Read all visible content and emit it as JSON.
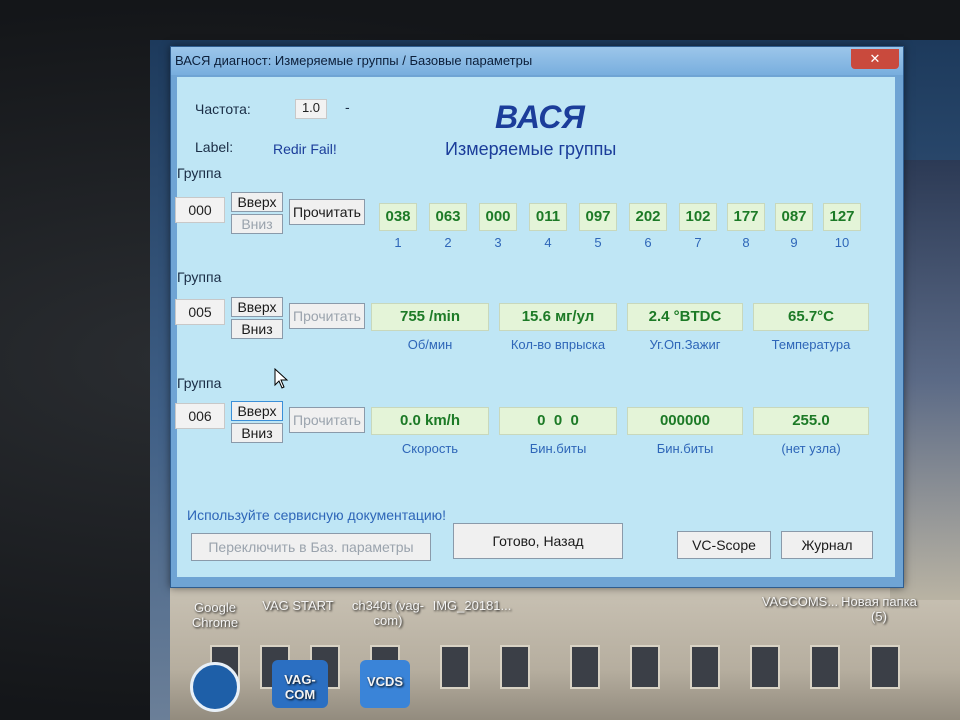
{
  "window": {
    "title": "ВАСЯ диагност: Измеряемые группы / Базовые параметры",
    "close": "✕"
  },
  "header": {
    "freq_label": "Частота:",
    "freq_value": "1.0",
    "freq_dash": "-",
    "label_label": "Label:",
    "label_value": "Redir Fail!",
    "app_name": "ВАСЯ",
    "subtitle": "Измеряемые группы"
  },
  "group_label": "Группа",
  "buttons": {
    "up": "Вверх",
    "down": "Вниз",
    "read": "Прочитать"
  },
  "group1": {
    "number": "000",
    "values": [
      "038",
      "063",
      "000",
      "011",
      "097",
      "202",
      "102",
      "177",
      "087",
      "127"
    ],
    "indexes": [
      "1",
      "2",
      "3",
      "4",
      "5",
      "6",
      "7",
      "8",
      "9",
      "10"
    ]
  },
  "group2": {
    "number": "005",
    "values": [
      "755 /min",
      "15.6 мг/ул",
      "2.4 °BTDC",
      "65.7°C"
    ],
    "captions": [
      "Об/мин",
      "Кол-во впрыска",
      "Уг.Оп.Зажиг",
      "Температура"
    ]
  },
  "group3": {
    "number": "006",
    "values": [
      "0.0 km/h",
      "0  0  0",
      "000000",
      "255.0"
    ],
    "captions": [
      "Скорость",
      "Бин.биты",
      "Бин.биты",
      "(нет узла)"
    ]
  },
  "footer": {
    "hint": "Используйте сервисную документацию!",
    "switch": "Переключить в Баз. параметры",
    "done": "Готово, Назад",
    "scope": "VC-Scope",
    "journal": "Журнал"
  },
  "desktop": {
    "icons": [
      "Google Chrome",
      "VAG START",
      "ch340t (vag-com)",
      "IMG_20181...",
      "VAGCOMS...",
      "Новая папка (5)",
      "VAG-COM",
      "VCDS"
    ]
  }
}
